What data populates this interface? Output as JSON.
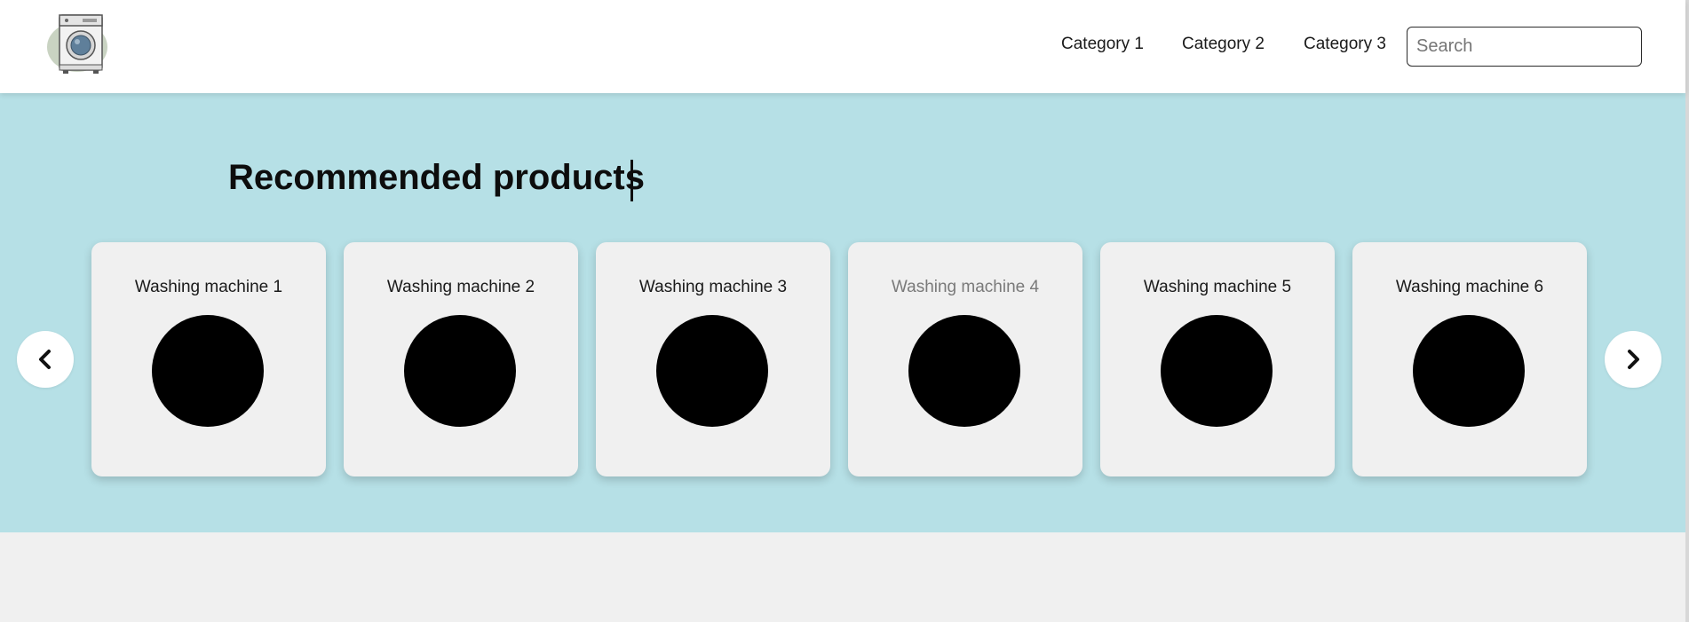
{
  "header": {
    "logo_icon": "washing-machine-logo-icon",
    "nav": [
      {
        "label": "Category 1"
      },
      {
        "label": "Category 2"
      },
      {
        "label": "Category 3"
      }
    ],
    "search": {
      "placeholder": "Search",
      "value": ""
    }
  },
  "main": {
    "title": "Recommended products",
    "prev_icon": "chevron-left-icon",
    "next_icon": "chevron-right-icon",
    "products": [
      {
        "name": "Washing machine 1"
      },
      {
        "name": "Washing machine 2"
      },
      {
        "name": "Washing machine 3"
      },
      {
        "name": "Washing machine 4"
      },
      {
        "name": "Washing machine 5"
      },
      {
        "name": "Washing machine 6"
      }
    ]
  },
  "colors": {
    "band_background": "#b6e0e6",
    "card_background": "#f0f0f0",
    "page_background": "#f0f0f0",
    "header_background": "#ffffff",
    "dimmed_text": "#7a7a7a"
  }
}
